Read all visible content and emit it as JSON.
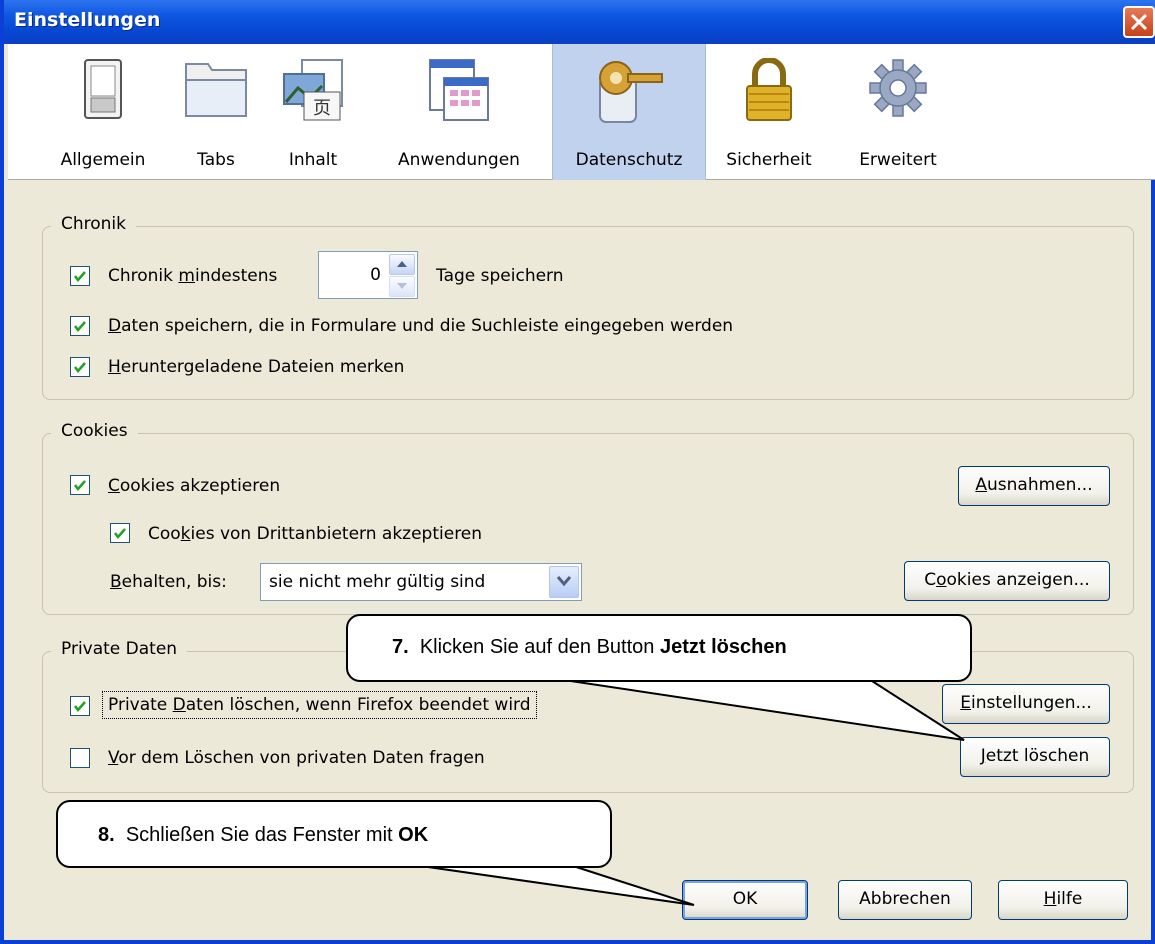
{
  "window": {
    "title": "Einstellungen"
  },
  "toolbar": {
    "tabs": [
      {
        "label": "Allgemein",
        "icon": "switch-icon"
      },
      {
        "label": "Tabs",
        "icon": "folder-tabs-icon"
      },
      {
        "label": "Inhalt",
        "icon": "content-icon"
      },
      {
        "label": "Anwendungen",
        "icon": "applications-icon"
      },
      {
        "label": "Datenschutz",
        "icon": "privacy-key-icon",
        "selected": true
      },
      {
        "label": "Sicherheit",
        "icon": "lock-icon"
      },
      {
        "label": "Erweitert",
        "icon": "gear-icon"
      }
    ]
  },
  "chronik": {
    "title": "Chronik",
    "keep_history_pre": "Chronik ",
    "keep_history_ul": "m",
    "keep_history_post": "indestens",
    "days_value": "0",
    "days_suffix": "Tage speichern",
    "form_data_ul": "D",
    "form_data_rest": "aten speichern, die in Formulare und die Suchleiste eingegeben werden",
    "downloads_ul": "H",
    "downloads_rest": "eruntergeladene Dateien merken"
  },
  "cookies": {
    "title": "Cookies",
    "accept_ul": "C",
    "accept_rest": "ookies akzeptieren",
    "third_party_pre": "Coo",
    "third_party_ul": "k",
    "third_party_rest": "ies von Drittanbietern akzeptieren",
    "keep_until_ul": "B",
    "keep_until_rest": "ehalten, bis:",
    "keep_until_value": "sie nicht mehr gültig sind",
    "exceptions_ul": "A",
    "exceptions_rest": "usnahmen...",
    "show_pre": "C",
    "show_ul": "o",
    "show_rest": "okies anzeigen..."
  },
  "private": {
    "title": "Private Daten",
    "clear_on_exit_pre": "Private ",
    "clear_on_exit_ul": "D",
    "clear_on_exit_rest": "aten löschen, wenn Firefox beendet wird",
    "ask_ul": "V",
    "ask_rest": "or dem Löschen von privaten Daten fragen",
    "settings_ul": "E",
    "settings_rest": "instellungen...",
    "clear_now_ul": "J",
    "clear_now_rest": "etzt löschen"
  },
  "footer": {
    "ok": "OK",
    "cancel": "Abbrechen",
    "help_ul": "H",
    "help_rest": "ilfe"
  },
  "callouts": [
    {
      "number": "7.",
      "text": "Klicken Sie auf den Button",
      "bold": "Jetzt löschen"
    },
    {
      "number": "8.",
      "text": "Schließen Sie das Fenster mit",
      "bold": "OK"
    }
  ],
  "colors": {
    "titlebar": "#0a48d3",
    "selected_tab": "#c1d2ee",
    "face": "#ece9d8"
  }
}
